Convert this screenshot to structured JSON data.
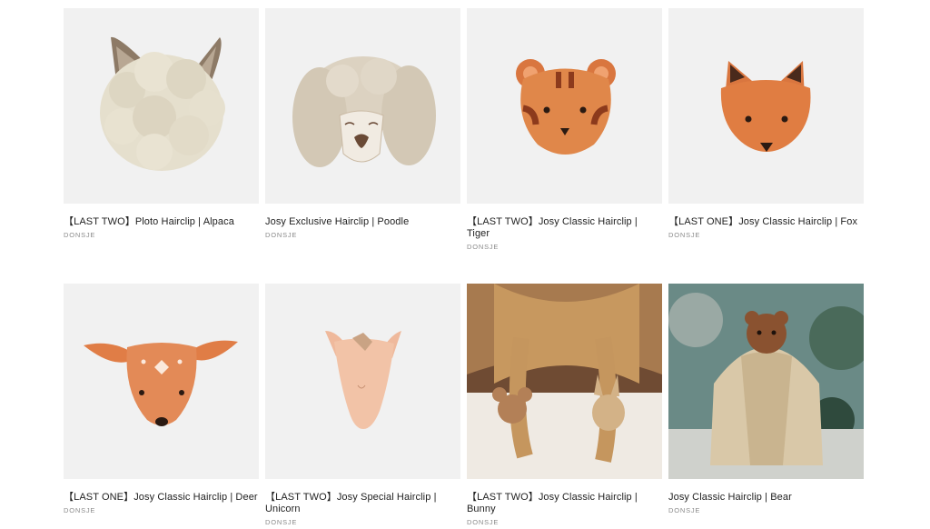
{
  "products": [
    {
      "title": "【LAST TWO】Ploto Hairclip | Alpaca",
      "brand": "DONSJE",
      "image": "alpaca-hairclip"
    },
    {
      "title": "Josy Exclusive Hairclip | Poodle",
      "brand": "DONSJE",
      "image": "poodle-hairclip"
    },
    {
      "title": "【LAST TWO】Josy Classic Hairclip | Tiger",
      "brand": "DONSJE",
      "image": "tiger-hairclip"
    },
    {
      "title": "【LAST ONE】Josy Classic Hairclip | Fox",
      "brand": "DONSJE",
      "image": "fox-hairclip"
    },
    {
      "title": "【LAST ONE】Josy Classic Hairclip | Deer",
      "brand": "DONSJE",
      "image": "deer-hairclip"
    },
    {
      "title": "【LAST TWO】Josy Special Hairclip | Unicorn",
      "brand": "DONSJE",
      "image": "unicorn-hairclip"
    },
    {
      "title": "【LAST TWO】Josy Classic Hairclip | Bunny",
      "brand": "DONSJE",
      "image": "braids-photo"
    },
    {
      "title": "Josy Classic Hairclip | Bear",
      "brand": "DONSJE",
      "image": "ponytail-photo"
    }
  ],
  "colors": {
    "tile_bg": "#f1f1f1",
    "leather": "#d9763f",
    "brand_text": "#8a8a8a"
  }
}
